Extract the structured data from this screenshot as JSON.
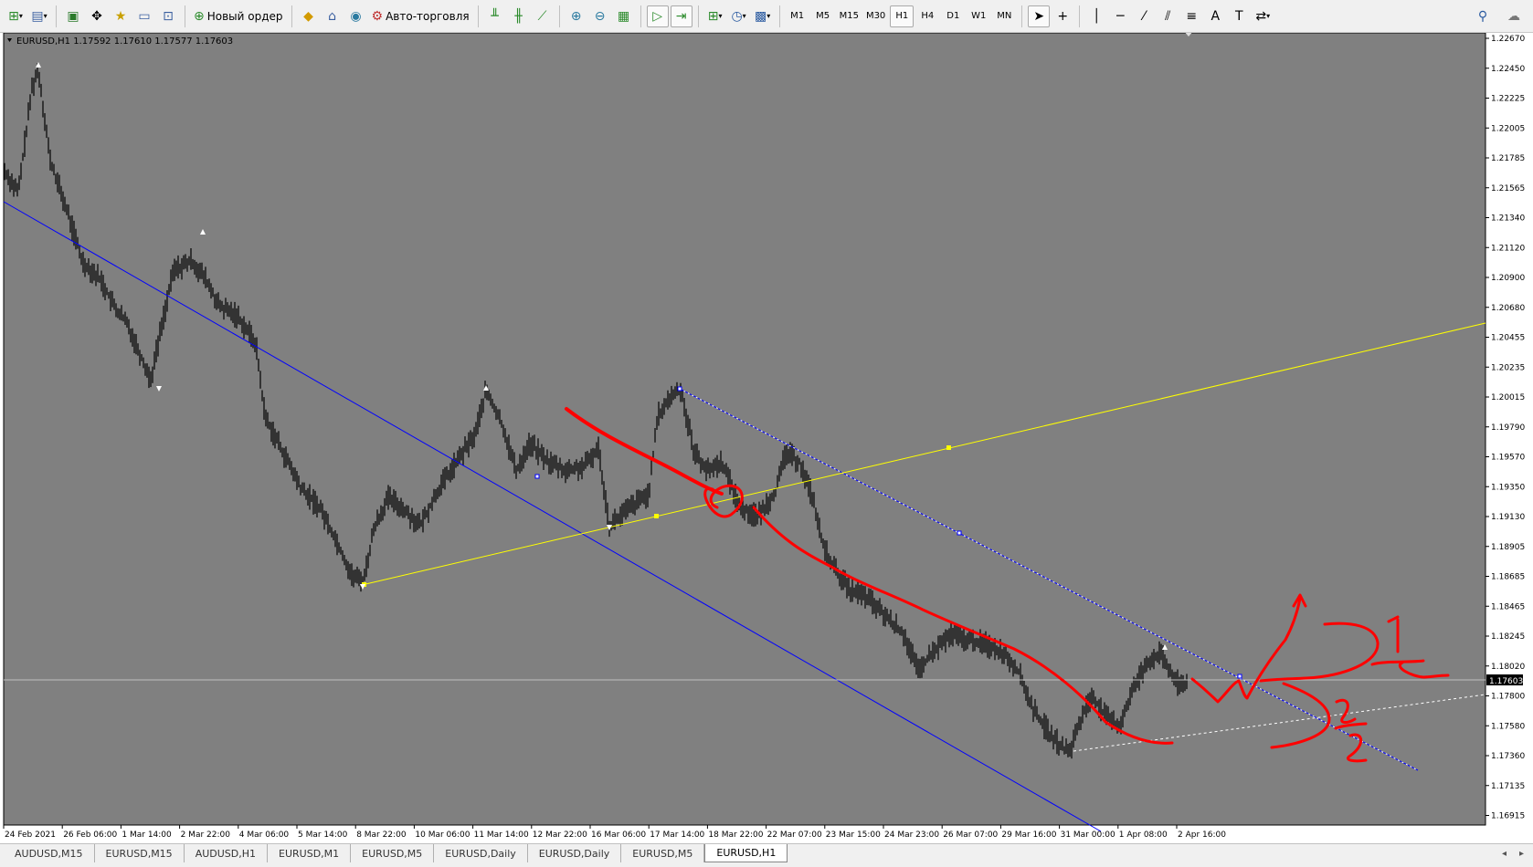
{
  "toolbar": {
    "new_order_label": "Новый ордер",
    "autotrade_label": "Авто-торговля",
    "timeframes": [
      "M1",
      "M5",
      "M15",
      "M30",
      "H1",
      "H4",
      "D1",
      "W1",
      "MN"
    ],
    "active_timeframe": "H1"
  },
  "chart": {
    "info_line": "EURUSD,H1  1.17592 1.17610 1.17577 1.17603",
    "current_price": "1.17603",
    "price_ticks": [
      "1.22670",
      "1.22450",
      "1.22225",
      "1.22005",
      "1.21785",
      "1.21565",
      "1.21340",
      "1.21120",
      "1.20900",
      "1.20680",
      "1.20455",
      "1.20235",
      "1.20015",
      "1.19790",
      "1.19570",
      "1.19350",
      "1.19130",
      "1.18905",
      "1.18685",
      "1.18465",
      "1.18245",
      "1.18020",
      "1.17800",
      "1.17580",
      "1.17360",
      "1.17135",
      "1.16915"
    ],
    "time_ticks": [
      "24 Feb 2021",
      "26 Feb 06:00",
      "1 Mar 14:00",
      "2 Mar 22:00",
      "4 Mar 06:00",
      "5 Mar 14:00",
      "8 Mar 22:00",
      "10 Mar 06:00",
      "11 Mar 14:00",
      "12 Mar 22:00",
      "16 Mar 06:00",
      "17 Mar 14:00",
      "18 Mar 22:00",
      "22 Mar 07:00",
      "23 Mar 15:00",
      "24 Mar 23:00",
      "26 Mar 07:00",
      "29 Mar 16:00",
      "31 Mar 00:00",
      "1 Apr 08:00",
      "2 Apr 16:00"
    ],
    "colors": {
      "background": "#808080",
      "candles": "#000000",
      "channel": "#0000ff",
      "trend": "#ffff00",
      "markup": "#ff0000",
      "price_line": "#c0c0c0"
    }
  },
  "tabs": [
    "AUDUSD,M15",
    "EURUSD,M15",
    "AUDUSD,H1",
    "EURUSD,M1",
    "EURUSD,M5",
    "EURUSD,Daily",
    "EURUSD,Daily",
    "EURUSD,M5",
    "EURUSD,H1"
  ],
  "active_tab_index": 8
}
